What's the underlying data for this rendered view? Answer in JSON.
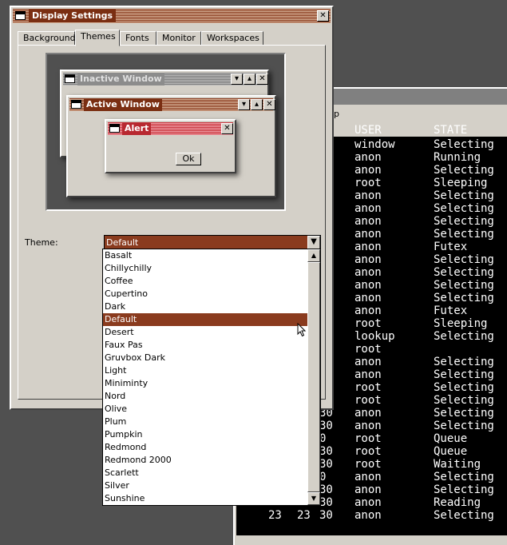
{
  "dialog": {
    "title": "Display Settings",
    "close_label": "✕",
    "tabs": [
      "Background",
      "Themes",
      "Fonts",
      "Monitor",
      "Workspaces"
    ],
    "active_tab": "Themes",
    "preview": {
      "inactive_title": "Inactive Window",
      "active_title": "Active Window",
      "alert_title": "Alert",
      "ok_label": "Ok",
      "min_label": "▾",
      "max_label": "▴",
      "close_label": "✕"
    },
    "theme_label": "Theme:",
    "theme_selected": "Default",
    "theme_options": [
      "Basalt",
      "Chillychilly",
      "Coffee",
      "Cupertino",
      "Dark",
      "Default",
      "Desert",
      "Faux Pas",
      "Gruvbox Dark",
      "Light",
      "Miniminty",
      "Nord",
      "Olive",
      "Plum",
      "Pumpkin",
      "Redmond",
      "Redmond 2000",
      "Scarlett",
      "Silver",
      "Sunshine"
    ]
  },
  "terminal": {
    "menu_fragment": "p",
    "headers": {
      "user": "USER",
      "state": "STATE"
    },
    "rows": [
      {
        "a": "",
        "b": "",
        "c": "",
        "user": "window",
        "state": "Selecting"
      },
      {
        "a": "",
        "b": "",
        "c": "",
        "user": "anon",
        "state": "Running"
      },
      {
        "a": "",
        "b": "",
        "c": "",
        "user": "anon",
        "state": "Selecting"
      },
      {
        "a": "",
        "b": "",
        "c": "",
        "user": "root",
        "state": "Sleeping"
      },
      {
        "a": "",
        "b": "",
        "c": "",
        "user": "anon",
        "state": "Selecting"
      },
      {
        "a": "",
        "b": "",
        "c": "",
        "user": "anon",
        "state": "Selecting"
      },
      {
        "a": "",
        "b": "",
        "c": "",
        "user": "anon",
        "state": "Selecting"
      },
      {
        "a": "",
        "b": "",
        "c": "",
        "user": "anon",
        "state": "Selecting"
      },
      {
        "a": "",
        "b": "",
        "c": "",
        "user": "anon",
        "state": "Futex"
      },
      {
        "a": "",
        "b": "",
        "c": "",
        "user": "anon",
        "state": "Selecting"
      },
      {
        "a": "",
        "b": "",
        "c": "",
        "user": "anon",
        "state": "Selecting"
      },
      {
        "a": "",
        "b": "",
        "c": "",
        "user": "anon",
        "state": "Selecting"
      },
      {
        "a": "",
        "b": "",
        "c": "",
        "user": "anon",
        "state": "Selecting"
      },
      {
        "a": "",
        "b": "",
        "c": "",
        "user": "anon",
        "state": "Futex"
      },
      {
        "a": "",
        "b": "",
        "c": "",
        "user": "root",
        "state": "Sleeping"
      },
      {
        "a": "",
        "b": "",
        "c": "",
        "user": "lookup",
        "state": "Selecting"
      },
      {
        "a": "",
        "b": "",
        "c": "",
        "user": "root",
        "state": ""
      },
      {
        "a": "",
        "b": "",
        "c": "",
        "user": "anon",
        "state": "Selecting"
      },
      {
        "a": "",
        "b": "",
        "c": "",
        "user": "anon",
        "state": "Selecting"
      },
      {
        "a": "",
        "b": "",
        "c": "",
        "user": "root",
        "state": "Selecting"
      },
      {
        "a": "",
        "b": "",
        "c": "",
        "user": "root",
        "state": "Selecting"
      },
      {
        "a": "",
        "b": "",
        "c": "30",
        "user": "anon",
        "state": "Selecting"
      },
      {
        "a": "",
        "b": "",
        "c": "30",
        "user": "anon",
        "state": "Selecting"
      },
      {
        "a": "",
        "b": "",
        "c": "0",
        "user": "root",
        "state": "Queue"
      },
      {
        "a": "",
        "b": "",
        "c": "30",
        "user": "root",
        "state": "Queue"
      },
      {
        "a": "",
        "b": "",
        "c": "30",
        "user": "root",
        "state": "Waiting"
      },
      {
        "a": "",
        "b": "",
        "c": "0",
        "user": "anon",
        "state": "Selecting"
      },
      {
        "a": "",
        "b": "",
        "c": "30",
        "user": "anon",
        "state": "Selecting"
      },
      {
        "a": "",
        "b": "",
        "c": "30",
        "user": "anon",
        "state": "Reading"
      },
      {
        "a": "23",
        "b": "23",
        "c": "30",
        "user": "anon",
        "state": "Selecting"
      }
    ]
  },
  "colors": {
    "accent": "#8a3b1e",
    "alert": "#c8343c",
    "face": "#d4d0c8"
  }
}
